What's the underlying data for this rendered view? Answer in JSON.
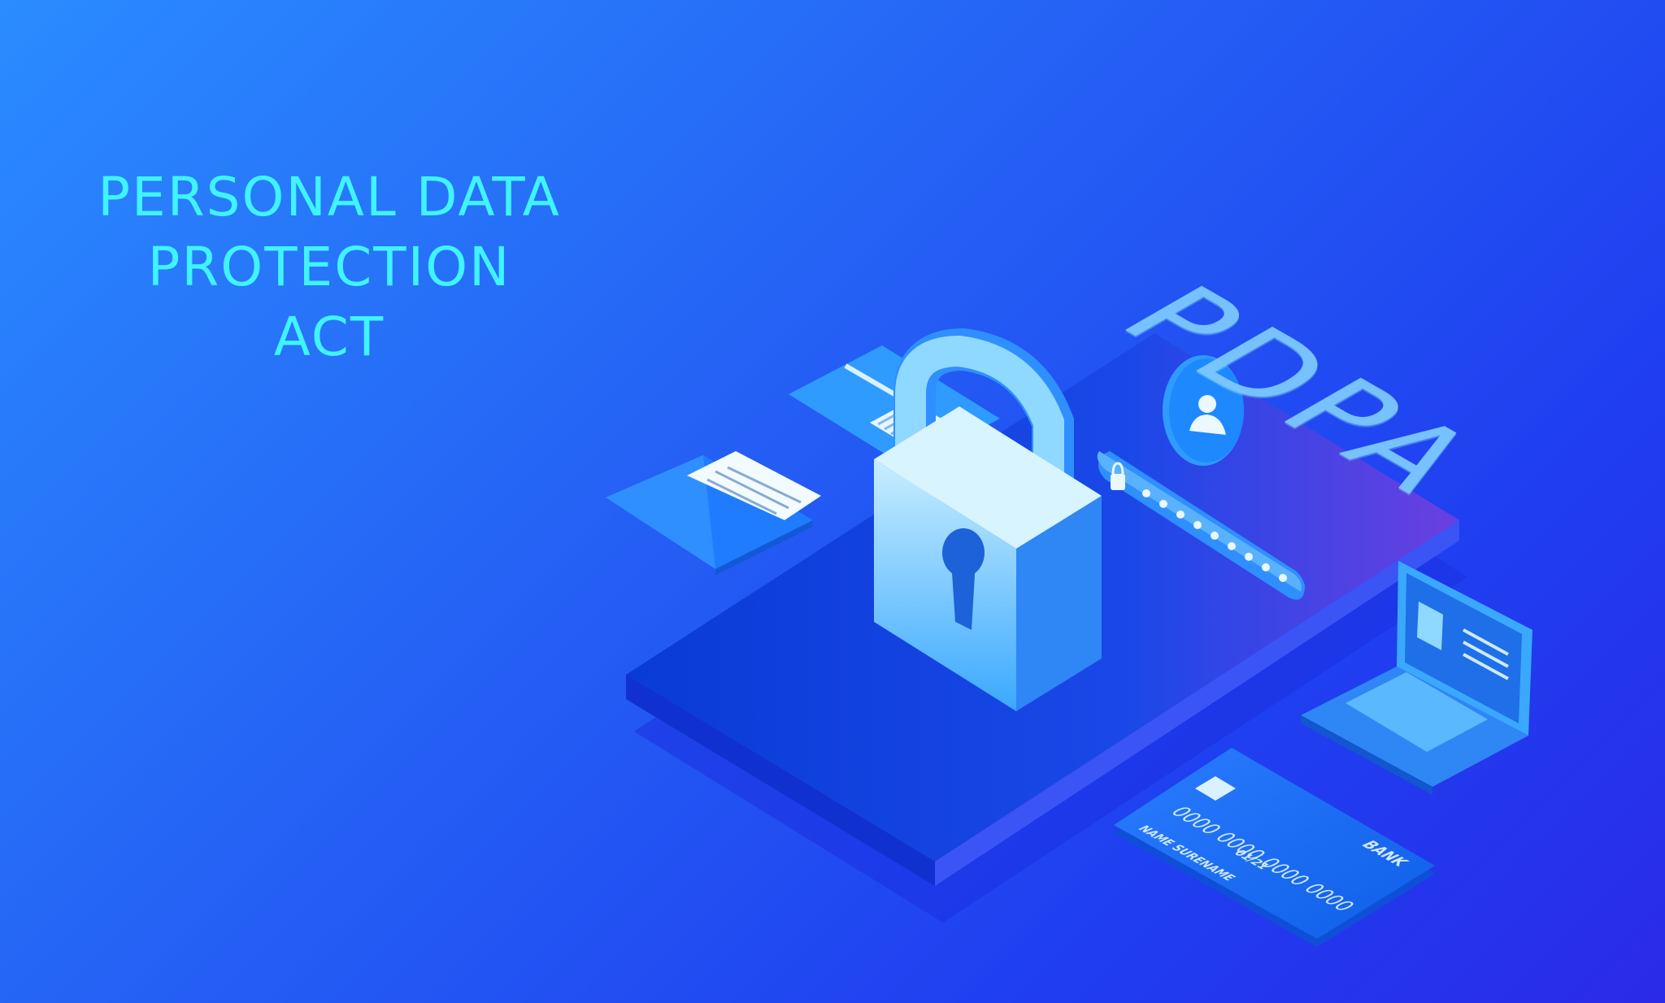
{
  "headline": {
    "line1": "PERSONAL DATA",
    "line2": "PROTECTION ACT"
  },
  "badge": "PDPA",
  "bank_card": {
    "number": "0000 0000 0000 0000",
    "name": "NAME SURENAME",
    "expiry": "01/21",
    "bank": "BANK"
  },
  "password": {
    "dot_count": 9
  },
  "colors": {
    "headline": "#3ff3ff",
    "background_start": "#2a8cff",
    "background_end": "#2b2ae8",
    "lock": "#8fd8ff"
  },
  "icons": [
    "padlock-icon",
    "envelope-icon",
    "id-card-icon",
    "user-avatar-icon",
    "password-field-icon",
    "laptop-icon",
    "bank-card-icon"
  ]
}
